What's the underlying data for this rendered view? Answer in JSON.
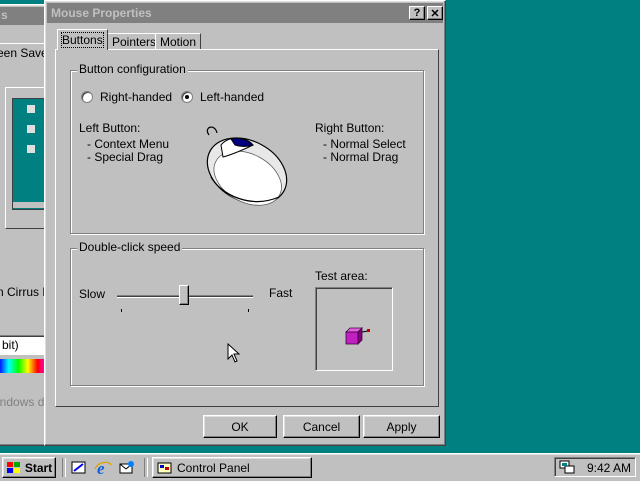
{
  "background_window": {
    "title_fragment": "s",
    "tab_fragment": "een Save",
    "monitor_label": "n Cirrus L",
    "color_select_value": "bit)",
    "footer_fragment": "indows d"
  },
  "dialog": {
    "title": "Mouse Properties",
    "help_btn": "?",
    "close_btn": "✕",
    "tabs": [
      {
        "label": "Buttons"
      },
      {
        "label": "Pointers"
      },
      {
        "label": "Motion"
      }
    ],
    "button_config": {
      "legend": "Button configuration",
      "right_handed": "Right-handed",
      "left_handed": "Left-handed",
      "selected": "left",
      "left_button_title": "Left Button:",
      "left_button_items": [
        "- Context Menu",
        "- Special Drag"
      ],
      "right_button_title": "Right Button:",
      "right_button_items": [
        "- Normal Select",
        "- Normal Drag"
      ]
    },
    "double_click": {
      "legend": "Double-click speed",
      "slow": "Slow",
      "fast": "Fast",
      "test_area": "Test area:",
      "speed_fraction": 0.5
    },
    "ok": "OK",
    "cancel": "Cancel",
    "apply": "Apply"
  },
  "taskbar": {
    "start": "Start",
    "task_label": "Control Panel",
    "clock": "9:42 AM"
  },
  "colors": {
    "desktop": "#008080",
    "inactive_titlebar": "#808080",
    "test_box": "#c020c0"
  }
}
